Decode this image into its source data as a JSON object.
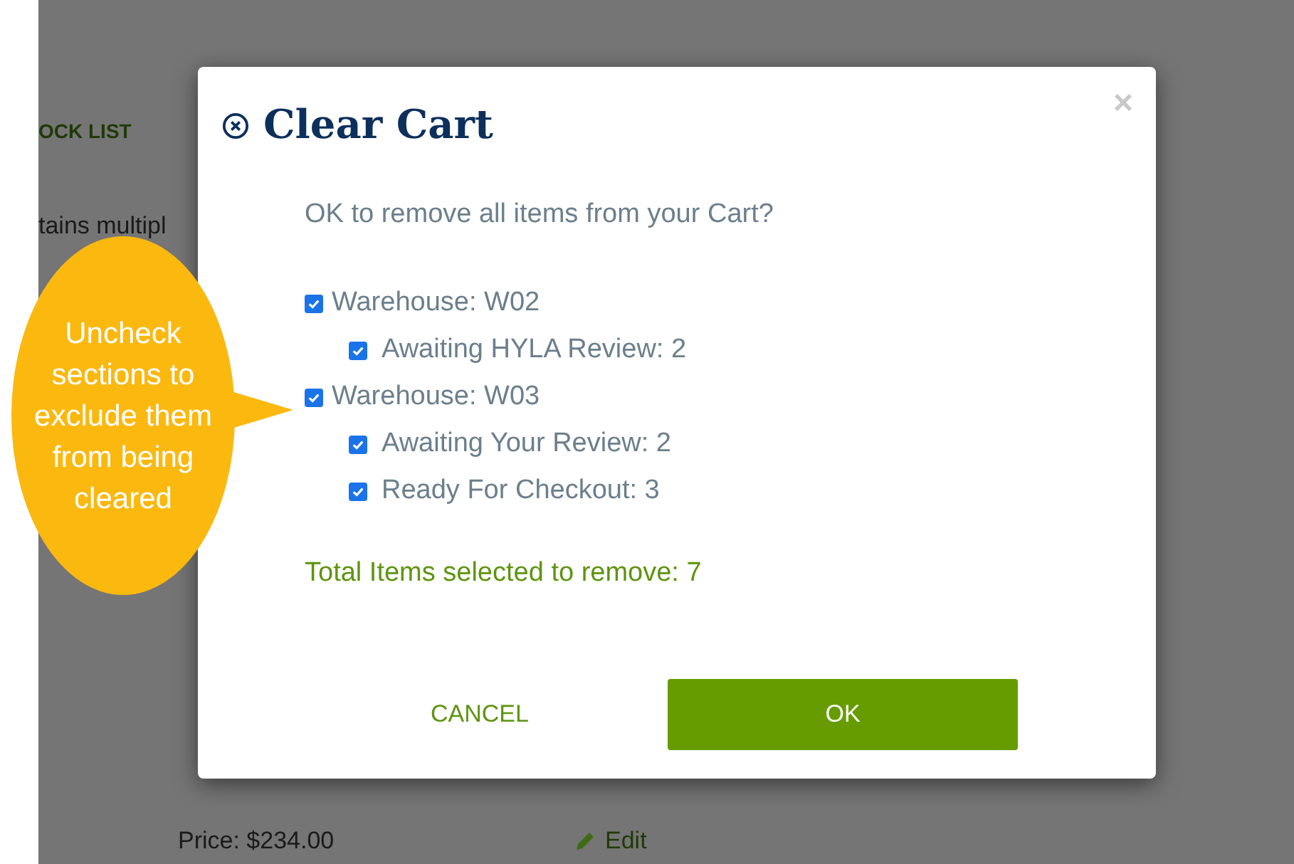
{
  "background": {
    "link": "OCK LIST",
    "text": "tains multipl",
    "price": "Price: $234.00",
    "edit": "Edit"
  },
  "callout": {
    "text": "Uncheck sections to exclude them from being cleared"
  },
  "dialog": {
    "title": "Clear Cart",
    "close": "×",
    "message": "OK to remove all items from your Cart?",
    "sections": [
      {
        "label": "Warehouse: W02",
        "checked": true,
        "children": [
          {
            "label": "Awaiting HYLA Review: 2",
            "checked": true
          }
        ]
      },
      {
        "label": "Warehouse: W03",
        "checked": true,
        "children": [
          {
            "label": "Awaiting Your Review: 2",
            "checked": true
          },
          {
            "label": "Ready For Checkout: 3",
            "checked": true
          }
        ]
      }
    ],
    "total": "Total Items selected to remove: 7",
    "buttons": {
      "cancel": "CANCEL",
      "ok": "OK"
    }
  }
}
